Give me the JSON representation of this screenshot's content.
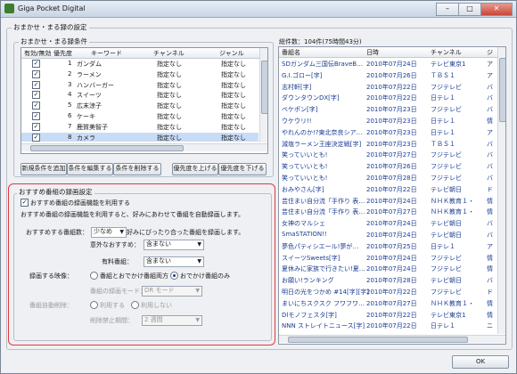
{
  "window": {
    "title": "Giga Pocket Digital",
    "min": "–",
    "max": "□",
    "close": "✕"
  },
  "auto_group": {
    "title": "おまかせ・まる録の設定"
  },
  "conditions": {
    "title": "おまかせ・まる録条件",
    "columns": [
      "有効/無効",
      "優先度",
      "キーワード",
      "チャンネル",
      "ジャンル"
    ],
    "rows": [
      {
        "priority": "1",
        "keyword": "ガンダム",
        "channel": "指定なし",
        "genre": "指定なし",
        "checked": true
      },
      {
        "priority": "2",
        "keyword": "ラーメン",
        "channel": "指定なし",
        "genre": "指定なし",
        "checked": true
      },
      {
        "priority": "3",
        "keyword": "ハンバーガー",
        "channel": "指定なし",
        "genre": "指定なし",
        "checked": true
      },
      {
        "priority": "4",
        "keyword": "スイーツ",
        "channel": "指定なし",
        "genre": "指定なし",
        "checked": true
      },
      {
        "priority": "5",
        "keyword": "広末涼子",
        "channel": "指定なし",
        "genre": "指定なし",
        "checked": true
      },
      {
        "priority": "6",
        "keyword": "ケーキ",
        "channel": "指定なし",
        "genre": "指定なし",
        "checked": true
      },
      {
        "priority": "7",
        "keyword": "鹿賀美智子",
        "channel": "指定なし",
        "genre": "指定なし",
        "checked": true
      },
      {
        "priority": "8",
        "keyword": "カメラ",
        "channel": "指定なし",
        "genre": "指定なし",
        "checked": true
      }
    ],
    "buttons": {
      "add": "新規条件を追加",
      "edit": "条件を編集する",
      "delete": "条件を削除する",
      "up": "優先度を上げる",
      "down": "優先度を下げる"
    }
  },
  "recommend": {
    "title": "おすすめ番組の録画設定",
    "enable_label": "おすすめ番組の録画機能を利用する",
    "description": "おすすめ番組の録画機能を利用すると、好みにあわせて番組を自動録画します。",
    "count_label": "おすすめする番組数：",
    "count_value": "少なめ",
    "count_note": "好みにぴったり合った番組を録画します。",
    "unexpected_label": "意外なおすすめ：",
    "unexpected_value": "含まない",
    "paid_label": "有料番組：",
    "paid_value": "含まない",
    "video_label": "録画する映像：",
    "video_opt1": "番組とおでかけ番組両方",
    "video_opt2": "おでかけ番組のみ",
    "mode_label": "番組の録画モード：",
    "mode_value": "DR モード",
    "autodel_label": "番組自動削除：",
    "autodel_opt1": "利用する",
    "autodel_opt2": "利用しない",
    "protect_label": "削除禁止期間：",
    "protect_value": "2 週間"
  },
  "results": {
    "summary": "総件数：104件(75時間43分)",
    "columns": [
      "番組名",
      "日時",
      "チャンネル",
      "ジ"
    ],
    "rows": [
      {
        "name": "SDガンダム三国伝BraveB…",
        "date": "2010年07月24日",
        "channel": "テレビ東京1",
        "g": "ア"
      },
      {
        "name": "G.I.ゴロー[字]",
        "date": "2010年07月26日",
        "channel": "ＴＢＳ１",
        "g": "ア"
      },
      {
        "name": "志村軒[字]",
        "date": "2010年07月22日",
        "channel": "フジテレビ",
        "g": "バ"
      },
      {
        "name": "ダウンタウンDX[字]",
        "date": "2010年07月22日",
        "channel": "日テレ１",
        "g": "バ"
      },
      {
        "name": "ベケポン[字]",
        "date": "2010年07月23日",
        "channel": "フジテレビ",
        "g": "バ"
      },
      {
        "name": "ウケウリ!!",
        "date": "2010年07月23日",
        "channel": "日テレ１",
        "g": "情"
      },
      {
        "name": "やれんのか!?東北奈良シア…",
        "date": "2010年07月23日",
        "channel": "日テレ１",
        "g": "ア"
      },
      {
        "name": "減塩ラーメン王座決定戦[字]",
        "date": "2010年07月23日",
        "channel": "ＴＢＳ１",
        "g": "バ"
      },
      {
        "name": "笑っていいとも!",
        "date": "2010年07月27日",
        "channel": "フジテレビ",
        "g": "バ"
      },
      {
        "name": "笑っていいとも!",
        "date": "2010年07月26日",
        "channel": "フジテレビ",
        "g": "バ"
      },
      {
        "name": "笑っていいとも!",
        "date": "2010年07月28日",
        "channel": "フジテレビ",
        "g": "バ"
      },
      {
        "name": "おみやさん[字]",
        "date": "2010年07月22日",
        "channel": "テレビ朝日",
        "g": "ド"
      },
      {
        "name": "芸住まい自分流「手作り 表…",
        "date": "2010年07月24日",
        "channel": "ＮＨＫ教育１・",
        "g": "情"
      },
      {
        "name": "芸住まい自分流「手作り 表…",
        "date": "2010年07月27日",
        "channel": "ＮＨＫ教育１・",
        "g": "情"
      },
      {
        "name": "女神のマルシェ",
        "date": "2010年07月24日",
        "channel": "テレビ朝日",
        "g": "バ"
      },
      {
        "name": "SmaSTATION!!",
        "date": "2010年07月24日",
        "channel": "テレビ朝日",
        "g": "バ"
      },
      {
        "name": "夢色パティシエール!夢が…",
        "date": "2010年07月25日",
        "channel": "日テレ１",
        "g": "ア"
      },
      {
        "name": "スイーツSweets[字]",
        "date": "2010年07月24日",
        "channel": "フジテレビ",
        "g": "情"
      },
      {
        "name": "夏休みに家族で行きたい!夏…",
        "date": "2010年07月24日",
        "channel": "フジテレビ",
        "g": "情"
      },
      {
        "name": "お願い!ランキング",
        "date": "2010年07月28日",
        "channel": "テレビ朝日",
        "g": "バ"
      },
      {
        "name": "明日の光をつかめ #14[字][字]",
        "date": "2010年07月22日",
        "channel": "フジテレビ",
        "g": "ド"
      },
      {
        "name": "まいにちスクスク フワフワ…",
        "date": "2010年07月27日",
        "channel": "ＮＨＫ教育１・",
        "g": "情"
      },
      {
        "name": "Dlモノフェスタ[字]",
        "date": "2010年07月22日",
        "channel": "テレビ東京1",
        "g": "情"
      },
      {
        "name": "NNN ストレイトニュース[字]",
        "date": "2010年07月22日",
        "channel": "日テレ１",
        "g": "ニ"
      }
    ]
  },
  "footer": {
    "ok": "OK"
  },
  "colors": {
    "accent_red": "#e03a3a",
    "selected_row": "#c8dcf6",
    "link_blue": "#1a3c92"
  }
}
